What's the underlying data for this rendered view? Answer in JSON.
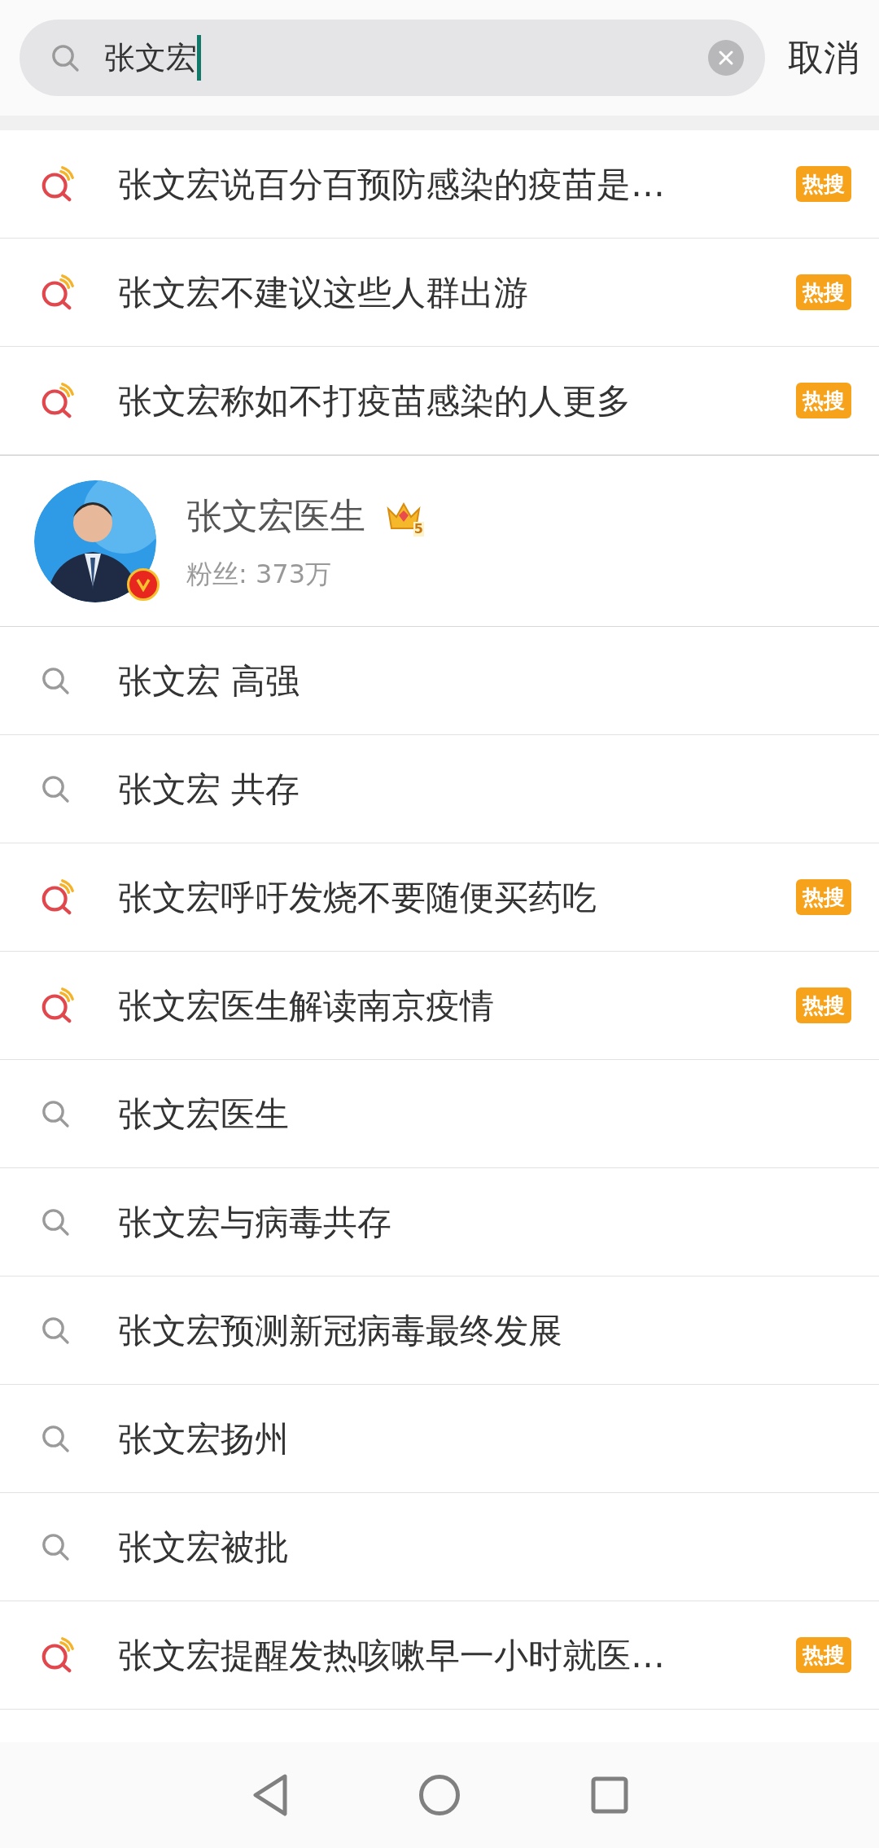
{
  "search": {
    "value": "张文宏",
    "cancel": "取消"
  },
  "rows": [
    {
      "kind": "hot",
      "text": "张文宏说百分百预防感染的疫苗是…",
      "badge": "热搜"
    },
    {
      "kind": "hot",
      "text": "张文宏不建议这些人群出游",
      "badge": "热搜"
    },
    {
      "kind": "hot",
      "text": "张文宏称如不打疫苗感染的人更多",
      "badge": "热搜"
    },
    {
      "kind": "user",
      "name": "张文宏医生",
      "crown_level": "5",
      "fans": "粉丝: 373万",
      "verified": true
    },
    {
      "kind": "plain",
      "text": "张文宏 高强"
    },
    {
      "kind": "plain",
      "text": "张文宏 共存"
    },
    {
      "kind": "hot",
      "text": "张文宏呼吁发烧不要随便买药吃",
      "badge": "热搜"
    },
    {
      "kind": "hot",
      "text": "张文宏医生解读南京疫情",
      "badge": "热搜"
    },
    {
      "kind": "plain",
      "text": "张文宏医生"
    },
    {
      "kind": "plain",
      "text": "张文宏与病毒共存"
    },
    {
      "kind": "plain",
      "text": "张文宏预测新冠病毒最终发展"
    },
    {
      "kind": "plain",
      "text": "张文宏扬州"
    },
    {
      "kind": "plain",
      "text": "张文宏被批"
    },
    {
      "kind": "hot",
      "text": "张文宏提醒发热咳嗽早一小时就医…",
      "badge": "热搜"
    }
  ]
}
